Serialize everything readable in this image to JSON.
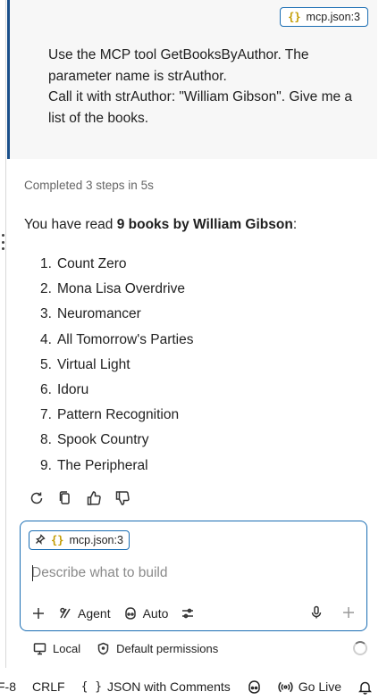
{
  "user_message": {
    "context_chip": "mcp.json:3",
    "lines": [
      "Use the MCP tool GetBooksByAuthor. The parameter name is strAuthor.",
      "Call it with strAuthor: \"William Gibson\". Give me a list of the books."
    ]
  },
  "response": {
    "status": "Completed 3 steps in 5s",
    "intro_prefix": "You have read ",
    "intro_bold": "9 books by William Gibson",
    "intro_suffix": ":",
    "books": [
      {
        "num": "1.",
        "title": "Count Zero"
      },
      {
        "num": "2.",
        "title": "Mona Lisa Overdrive"
      },
      {
        "num": "3.",
        "title": "Neuromancer"
      },
      {
        "num": "4.",
        "title": "All Tomorrow's Parties"
      },
      {
        "num": "5.",
        "title": "Virtual Light"
      },
      {
        "num": "6.",
        "title": "Idoru"
      },
      {
        "num": "7.",
        "title": "Pattern Recognition"
      },
      {
        "num": "8.",
        "title": "Spook Country"
      },
      {
        "num": "9.",
        "title": "The Peripheral"
      }
    ],
    "actions": [
      "retry-icon",
      "copy-icon",
      "thumbs-up-icon",
      "thumbs-down-icon"
    ]
  },
  "chat_input": {
    "attached_file": "mcp.json:3",
    "placeholder": "Describe what to build",
    "value": "",
    "mode_label": "Agent",
    "model_label": "Auto"
  },
  "footer": {
    "location_label": "Local",
    "permissions_label": "Default permissions"
  },
  "status_bar": {
    "encoding": "F-8",
    "line_ending": "CRLF",
    "language_icon": "{ }",
    "language": "JSON with Comments",
    "go_live": "Go Live"
  },
  "colors": {
    "accent": "#1a6db3",
    "user_bar": "#1a4f8a",
    "json_icon": "#c29b00"
  }
}
